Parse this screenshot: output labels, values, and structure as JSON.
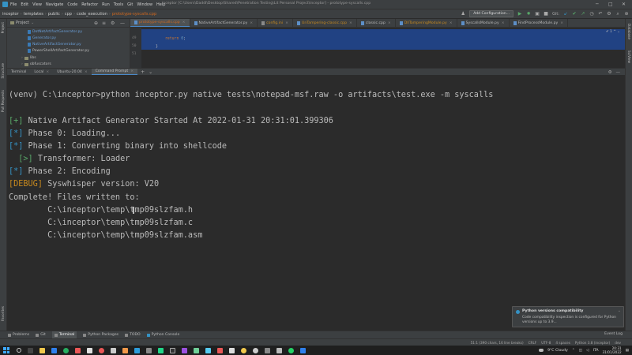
{
  "menubar": {
    "items": [
      "File",
      "Edit",
      "View",
      "Navigate",
      "Code",
      "Refactor",
      "Run",
      "Tools",
      "Git",
      "Window",
      "Help"
    ],
    "title": "inceptor [C:\\Users\\Daddl\\Desktop\\Shared\\Penetration Testing\\Lit Personal Project\\inceptor] - prototype-syscalls.cpp",
    "minimize": "─",
    "maximize": "□",
    "close": "✕"
  },
  "breadcrumbs": [
    "inceptor",
    "templates",
    "public",
    "cpp",
    "code_execution",
    "prototype-syscalls.cpp"
  ],
  "toolbar": {
    "config_label": "Add Configuration...",
    "git_label": "Git:"
  },
  "left_stripe": {
    "project": "Project",
    "structure": "Structure",
    "pull_requests": "Pull Requests",
    "favorites": "Favorites"
  },
  "right_stripe": {
    "database": "Database",
    "sciview": "SciView"
  },
  "project": {
    "header": "Project",
    "items": [
      {
        "label": "DotNetArtifactGenerator.py",
        "kind": "file",
        "color": "#6a9fd8"
      },
      {
        "label": "Generator.py",
        "kind": "file",
        "color": "#6a9fd8"
      },
      {
        "label": "NativeArtifactGenerator.py",
        "kind": "file",
        "color": "#6a9fd8"
      },
      {
        "label": "PowerShellArtifactGenerator.py",
        "kind": "file",
        "color": "#cfcfcf"
      },
      {
        "label": "libs",
        "kind": "folder",
        "color": "#bbbbbb"
      },
      {
        "label": "obfuscators",
        "kind": "folder",
        "color": "#bbbbbb"
      }
    ]
  },
  "editor_tabs": [
    {
      "label": "prototype-syscalls.cpp",
      "active": true
    },
    {
      "label": "NativeArtifactGenerator.py",
      "active": false
    },
    {
      "label": "config.ini",
      "active": false
    },
    {
      "label": "UnTampering-classic.cpp",
      "active": false
    },
    {
      "label": "classic.cpp",
      "active": false
    },
    {
      "label": "DllTamperingModule.py",
      "active": false
    },
    {
      "label": "SyscallsModule.py",
      "active": false
    },
    {
      "label": "FindProcessModule.py",
      "active": false
    }
  ],
  "editor": {
    "line_numbers": [
      "49",
      "50",
      "51"
    ],
    "code_keyword": "return",
    "code_value": "0",
    "code_tail": ";",
    "closing": "}",
    "inspection": "✔ 1 ^ ⌄"
  },
  "terminal_tabs": [
    {
      "label": "Terminal",
      "active": false
    },
    {
      "label": "Local",
      "active": false
    },
    {
      "label": "Ubuntu-20.04",
      "active": false
    },
    {
      "label": "Command Prompt",
      "active": true
    }
  ],
  "terminal": {
    "command": "(venv) C:\\inceptor>python inceptor.py native tests\\notepad-msf.raw -o artifacts\\test.exe -m syscalls",
    "lines": [
      {
        "tag": "[+]",
        "text": " Native Artifact Generator Started At 2022-01-31 20:31:01.399306",
        "indent": ""
      },
      {
        "tag": "[*]",
        "text": " Phase 0: Loading...",
        "indent": ""
      },
      {
        "tag": "[*]",
        "text": " Phase 1: Converting binary into shellcode",
        "indent": ""
      },
      {
        "tag": "[>]",
        "text": " Transformer: Loader",
        "indent": "  "
      },
      {
        "tag": "[*]",
        "text": " Phase 2: Encoding",
        "indent": ""
      },
      {
        "tag": "[DEBUG]",
        "text": " Syswhisper version: V20",
        "indent": ""
      }
    ],
    "complete": "Complete! Files written to:",
    "files": [
      "        C:\\inceptor\\temp\\tmp09slzfam.h",
      "        C:\\inceptor\\temp\\tmp09slzfam.c",
      "        C:\\inceptor\\temp\\tmp09slzfam.asm"
    ]
  },
  "toast": {
    "title": "Python versions compatibility",
    "body": "Code compatibility inspection is configured for Python versions up to 3.9..."
  },
  "tool_windows": [
    {
      "label": "Problems",
      "active": false
    },
    {
      "label": "Git",
      "active": false
    },
    {
      "label": "Terminal",
      "active": true
    },
    {
      "label": "Python Packages",
      "active": false
    },
    {
      "label": "TODO",
      "active": false
    },
    {
      "label": "Python Console",
      "active": false
    }
  ],
  "event_log": "Event Log",
  "statusbar": [
    "51:1 (390 chars, 16 line breaks)",
    "CRLF",
    "UTF-8",
    "4 spaces",
    "Python 3.8 (inceptor)",
    "dev"
  ],
  "tray": {
    "weather": "9°C  Cloudy",
    "lang": "ITA",
    "time": "20:31",
    "date": "31/01/2022"
  },
  "colors": {
    "bg": "#2b2b2b",
    "panel": "#3c3f41",
    "selection": "#214283",
    "green": "#59a869",
    "blue": "#3592c4",
    "orange": "#c98a1e",
    "active_file": "#d2691e"
  }
}
